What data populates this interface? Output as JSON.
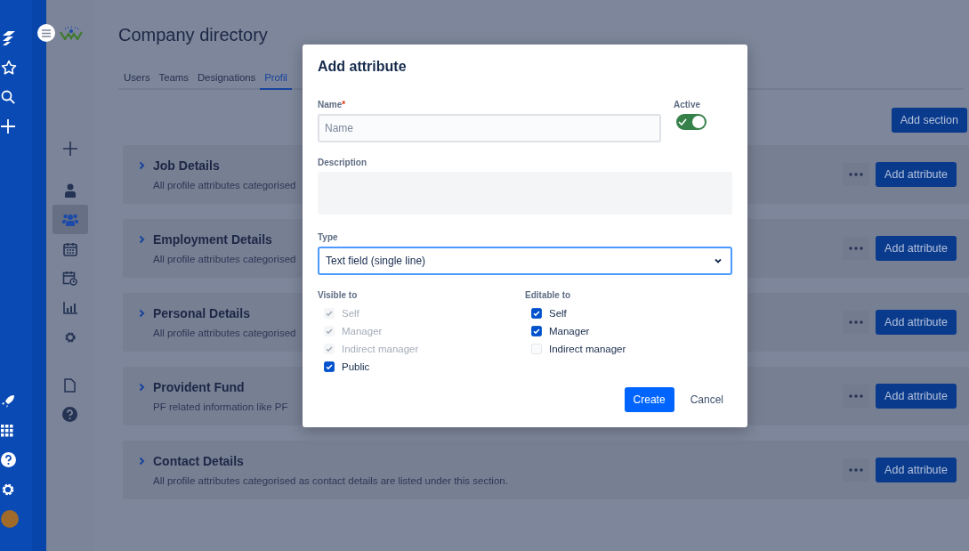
{
  "header": {
    "title": "Company directory"
  },
  "tabs": [
    {
      "label": "Users",
      "selected": false
    },
    {
      "label": "Teams",
      "selected": false
    },
    {
      "label": "Designations",
      "selected": false
    },
    {
      "label": "Profil",
      "selected": true
    }
  ],
  "sidebar": {
    "items": [
      {
        "kind": "plus",
        "selected": false
      },
      {
        "kind": "person",
        "selected": false
      },
      {
        "kind": "people",
        "selected": true
      },
      {
        "kind": "calendar",
        "selected": false
      },
      {
        "kind": "calendar-clock",
        "selected": false
      },
      {
        "kind": "chart",
        "selected": false
      },
      {
        "kind": "gear",
        "selected": false
      },
      {
        "kind": "document",
        "selected": false
      },
      {
        "kind": "help",
        "selected": false
      }
    ]
  },
  "add_section_button": "Add section",
  "sections": [
    {
      "title": "Job Details",
      "description": "All profile attributes categorised",
      "button": "Add attribute"
    },
    {
      "title": "Employment Details",
      "description": "All profile attributes categorised",
      "button": "Add attribute"
    },
    {
      "title": "Personal Details",
      "description": "All profile attributes categorised",
      "button": "Add attribute"
    },
    {
      "title": "Provident Fund",
      "description": "PF related information like PF",
      "button": "Add attribute"
    },
    {
      "title": "Contact Details",
      "description": "All profile attributes categorised as contact details are listed under this section.",
      "button": "Add attribute"
    }
  ],
  "dialog": {
    "title": "Add attribute",
    "name_field": {
      "label": "Name",
      "required_mark": "*",
      "placeholder": "Name"
    },
    "active": {
      "label": "Active",
      "on": true
    },
    "description": {
      "label": "Description"
    },
    "type": {
      "label": "Type",
      "value": "Text field (single line)"
    },
    "visible_to": {
      "label": "Visible to",
      "options": [
        {
          "label": "Self",
          "checked": true,
          "disabled": true
        },
        {
          "label": "Manager",
          "checked": true,
          "disabled": true
        },
        {
          "label": "Indirect manager",
          "checked": true,
          "disabled": true
        },
        {
          "label": "Public",
          "checked": true,
          "disabled": false
        }
      ]
    },
    "editable_to": {
      "label": "Editable to",
      "options": [
        {
          "label": "Self",
          "checked": true,
          "disabled": false
        },
        {
          "label": "Manager",
          "checked": true,
          "disabled": false
        },
        {
          "label": "Indirect manager",
          "checked": false,
          "disabled": false
        }
      ]
    },
    "buttons": [
      {
        "label": "Create",
        "kind": "primary"
      },
      {
        "label": "Cancel",
        "kind": "subtle"
      }
    ]
  }
}
